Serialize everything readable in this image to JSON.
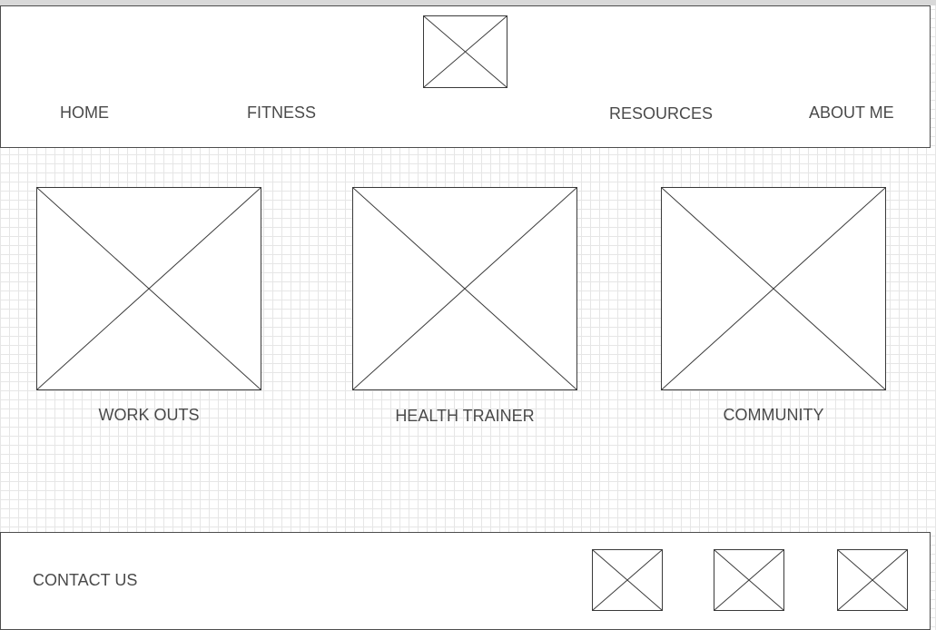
{
  "header": {
    "nav": {
      "home": "HOME",
      "fitness": "FITNESS",
      "resources": "RESOURCES",
      "about_me": "ABOUT ME"
    },
    "logo_icon": "image-placeholder-icon"
  },
  "cards": [
    {
      "label": "WORK OUTS",
      "icon": "image-placeholder-icon"
    },
    {
      "label": "HEALTH TRAINER",
      "icon": "image-placeholder-icon"
    },
    {
      "label": "COMMUNITY",
      "icon": "image-placeholder-icon"
    }
  ],
  "footer": {
    "contact_label": "CONTACT US",
    "social_icons": [
      "image-placeholder-icon",
      "image-placeholder-icon",
      "image-placeholder-icon"
    ]
  },
  "colors": {
    "border": "#3a3a3a",
    "text": "#4a4a4a",
    "grid": "#e6e6e6"
  }
}
